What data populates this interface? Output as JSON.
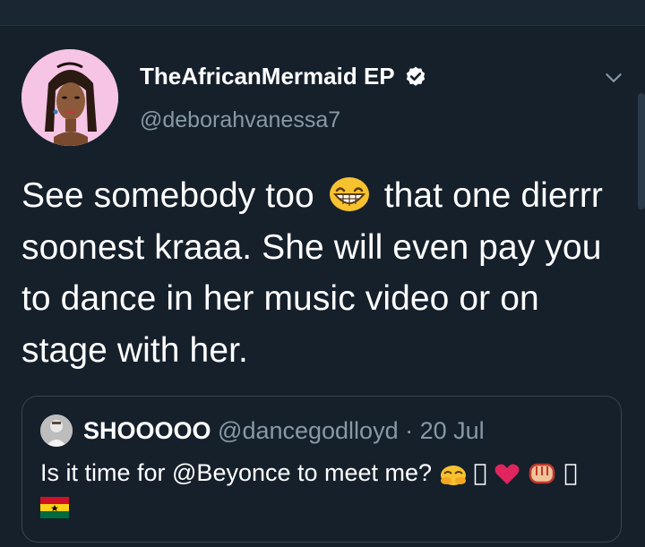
{
  "author": {
    "display_name": "TheAfricanMermaid EP",
    "handle": "@deborahvanessa7",
    "verified": true
  },
  "tweet": {
    "text_before_emoji": "See somebody too",
    "emoji": "grinning-face-with-smiling-eyes",
    "text_after_emoji": "that one dierrr soonest kraaa. She will even pay you to dance in her music video or on stage with her."
  },
  "quoted_tweet": {
    "display_name": "SHOOOOO",
    "handle": "@dancegodlloyd",
    "separator": "·",
    "date": "20 Jul",
    "text": "Is it time for @Beyonce to meet me?",
    "trailing_emojis": [
      "hiding-face",
      "missing-glyph",
      "red-heart",
      "raised-fist",
      "missing-glyph"
    ],
    "flag_emoji": "ghana-flag"
  },
  "colors": {
    "background": "#15202b",
    "text_primary": "#ffffff",
    "text_secondary": "#8899a6",
    "card_border": "#38444d",
    "avatar_bg": "#f6c4e4",
    "verified": "#ffffff"
  },
  "icons": {
    "verified": "verified-badge-icon",
    "menu": "chevron-down-icon"
  }
}
